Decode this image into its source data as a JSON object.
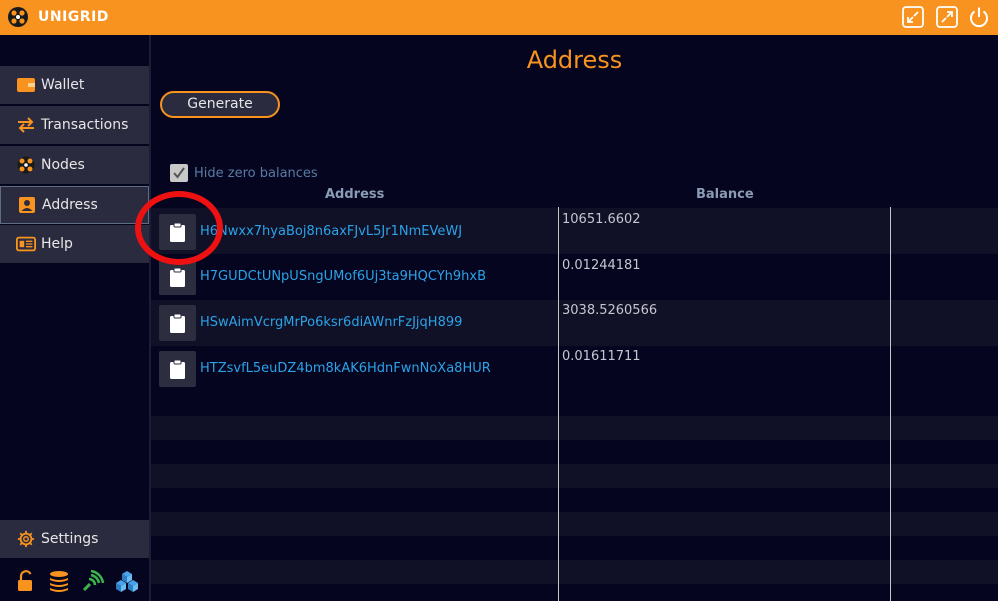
{
  "app": {
    "name": "UNIGRID"
  },
  "colors": {
    "accent": "#f7931e",
    "background": "#05051f",
    "link": "#2ba3e8",
    "highlight_circle": "#ee1111"
  },
  "sidebar": {
    "items": [
      {
        "label": "Wallet",
        "icon": "wallet-icon"
      },
      {
        "label": "Transactions",
        "icon": "transfer-arrows-icon"
      },
      {
        "label": "Nodes",
        "icon": "nodes-icon"
      },
      {
        "label": "Address",
        "icon": "address-card-icon",
        "active": true
      },
      {
        "label": "Help",
        "icon": "help-card-icon"
      }
    ],
    "settings_label": "Settings",
    "status_icons": [
      "lock-open-icon",
      "coins-icon",
      "network-signal-icon",
      "blocks-icon"
    ]
  },
  "main": {
    "title": "Address",
    "generate_label": "Generate",
    "hide_zero_label": "Hide zero balances",
    "hide_zero_checked": true,
    "columns": {
      "address": "Address",
      "balance": "Balance"
    },
    "rows": [
      {
        "address": "H6Nwxx7hyaBoj8n6axFJvL5Jr1NmEVeWJ",
        "balance": "10651.6602"
      },
      {
        "address": "H7GUDCtUNpUSngUMof6Uj3ta9HQCYh9hxB",
        "balance": "0.01244181"
      },
      {
        "address": "HSwAimVcrgMrPo6ksr6diAWnrFzJjqH899",
        "balance": "3038.5260566"
      },
      {
        "address": "HTZsvfL5euDZ4bm8kAK6HdnFwnNoXa8HUR",
        "balance": "0.01611711"
      }
    ]
  }
}
